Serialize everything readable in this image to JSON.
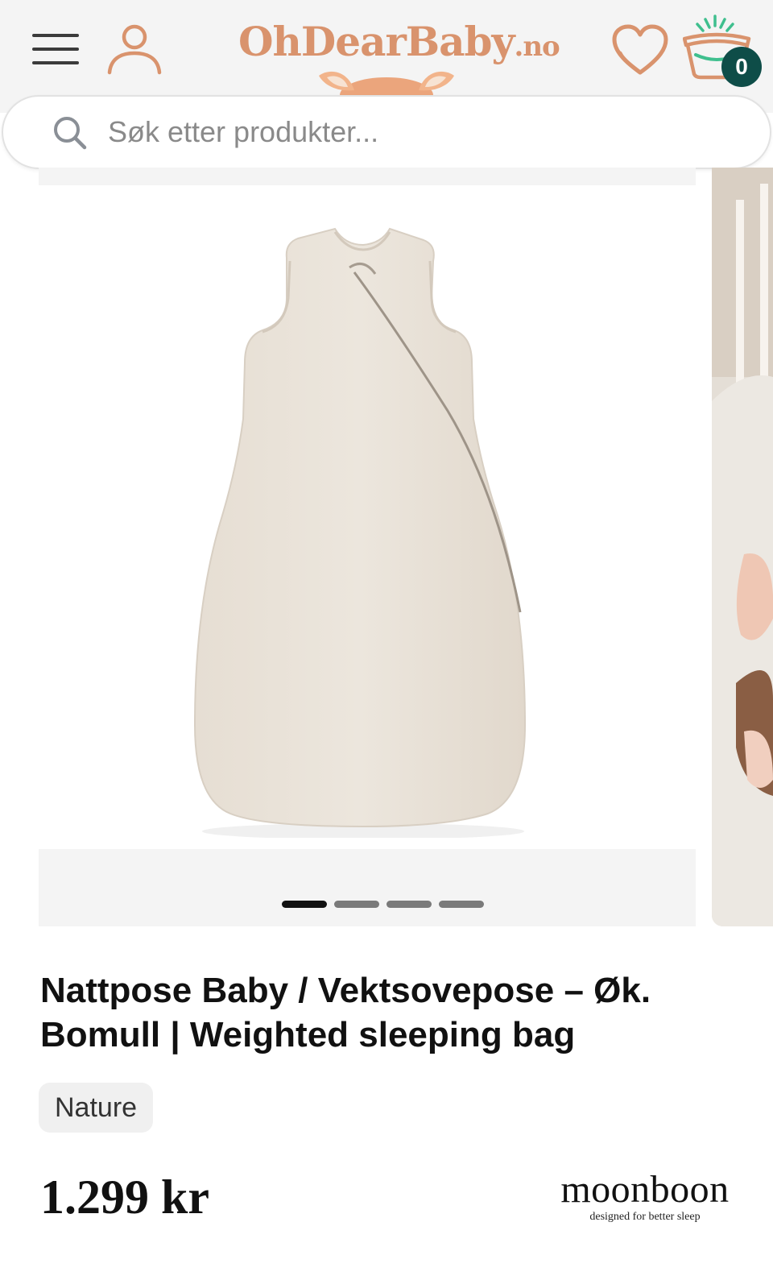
{
  "header": {
    "logo_main": "OhDearBaby",
    "logo_suffix": ".no",
    "cart_count": "0",
    "icons": [
      "menu-icon",
      "user-icon",
      "heart-icon",
      "basket-icon"
    ]
  },
  "search": {
    "placeholder": "Søk etter produkter..."
  },
  "gallery": {
    "image_count": 4,
    "active_index": 0
  },
  "product": {
    "title": "Nattpose Baby / Vektsovepose – Øk. Bomull | Weighted sleeping bag",
    "tag": "Nature",
    "price": "1.299 kr"
  },
  "brand": {
    "name": "moonboon",
    "tagline": "designed for better sleep"
  },
  "colors": {
    "brand_peach": "#d9936d",
    "cart_badge": "#0e4d48",
    "header_bg": "#f4f4f4"
  }
}
